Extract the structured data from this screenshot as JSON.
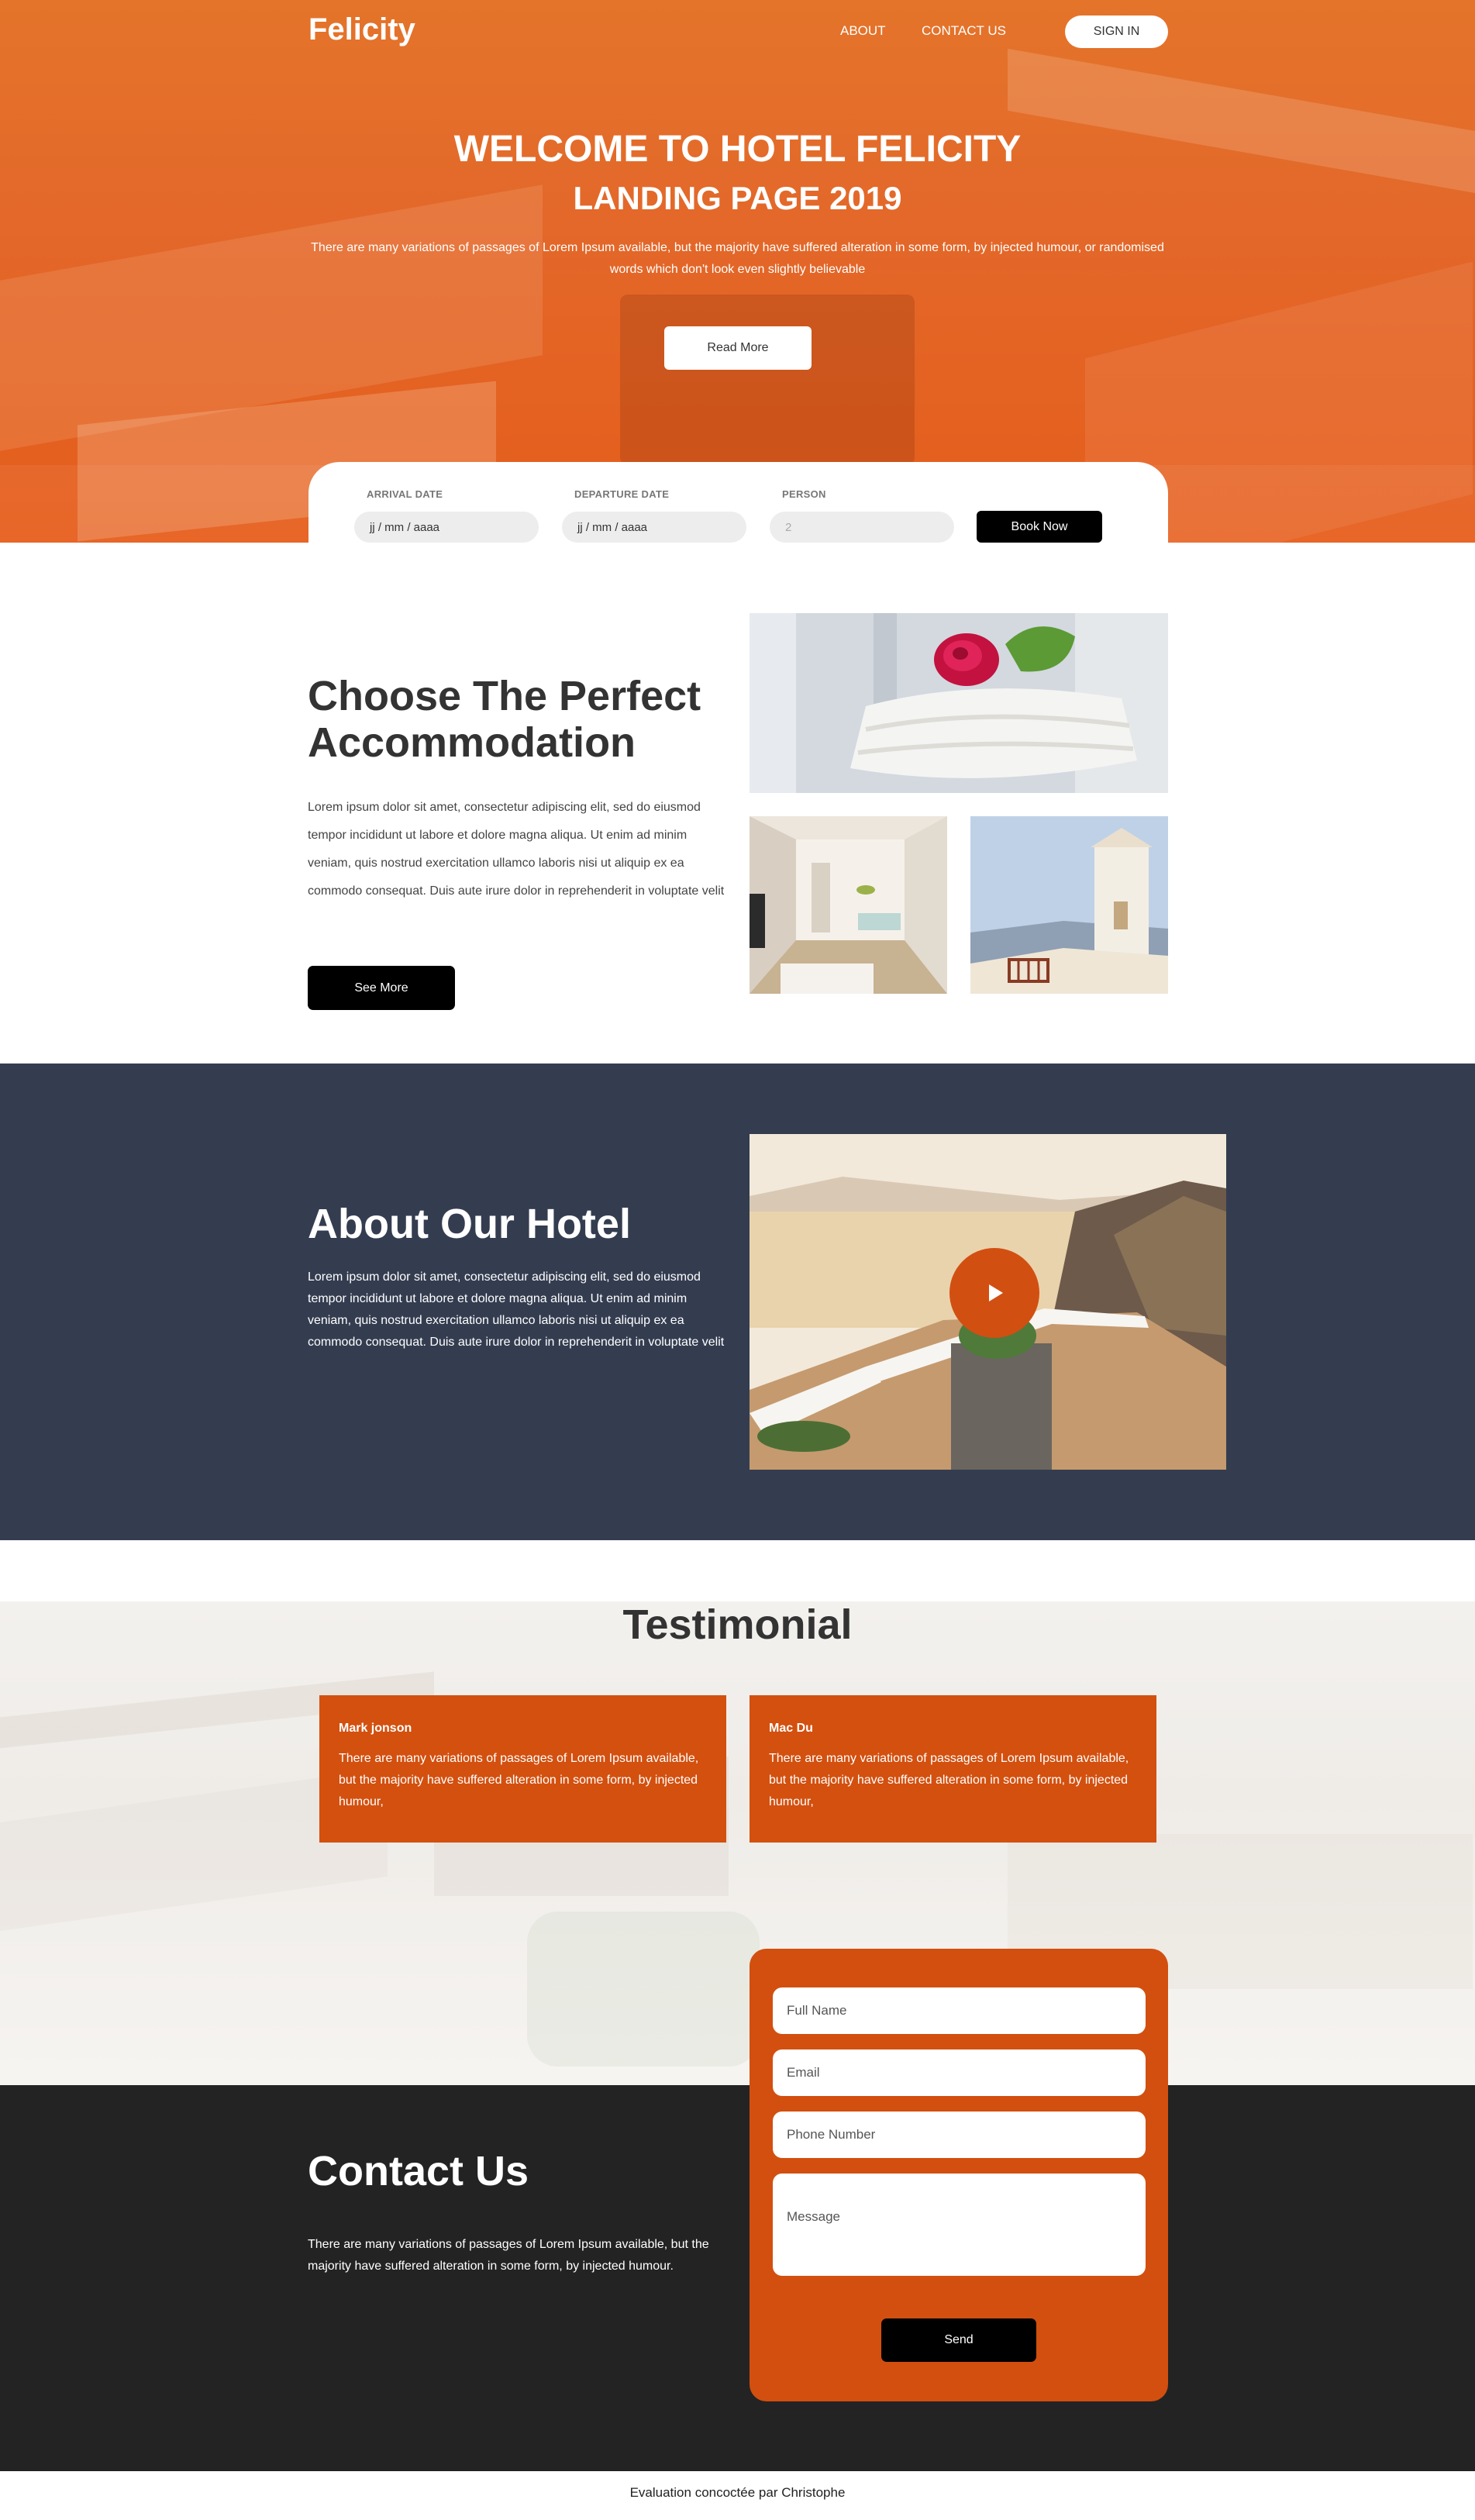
{
  "nav": {
    "logo": "Felicity",
    "about": "ABOUT",
    "contact": "CONTACT US",
    "signin": "SIGN IN"
  },
  "hero": {
    "title": "WELCOME TO HOTEL FELICITY",
    "subtitle": "LANDING PAGE 2019",
    "text": "There are many variations of passages of Lorem Ipsum available, but the majority have suffered alteration in some form, by injected humour, or randomised words which don't look even slightly believable",
    "button": "Read More"
  },
  "booking": {
    "arrival_label": "ARRIVAL DATE",
    "arrival_value": "jj / mm / aaaa",
    "departure_label": "DEPARTURE DATE",
    "departure_value": "jj / mm / aaaa",
    "person_label": "PERSON",
    "person_placeholder": "2",
    "button": "Book Now"
  },
  "accommodation": {
    "title": "Choose The Perfect Accommodation",
    "text": "Lorem ipsum dolor sit amet, consectetur adipiscing elit, sed do eiusmod tempor incididunt ut labore et dolore magna aliqua. Ut enim ad minim veniam, quis nostrud exercitation ullamco laboris nisi ut aliquip ex ea commodo consequat. Duis aute irure dolor in reprehenderit in voluptate velit",
    "button": "See More"
  },
  "about": {
    "title": "About Our Hotel",
    "text": "Lorem ipsum dolor sit amet, consectetur adipiscing elit, sed do eiusmod tempor incididunt ut labore et dolore magna aliqua. Ut enim ad minim veniam, quis nostrud exercitation ullamco laboris nisi ut aliquip ex ea commodo consequat. Duis aute irure dolor in reprehenderit in voluptate velit"
  },
  "testimonial": {
    "title": "Testimonial",
    "cards": [
      {
        "name": "Mark jonson",
        "text": "There are many variations of passages of Lorem Ipsum available, but the majority have suffered alteration in some form, by injected humour,"
      },
      {
        "name": "Mac Du",
        "text": "There are many variations of passages of Lorem Ipsum available, but the majority have suffered alteration in some form, by injected humour,"
      }
    ]
  },
  "contact": {
    "title": "Contact Us",
    "text": "There are many variations of passages of Lorem Ipsum available, but the majority have suffered alteration in some form, by injected humour.",
    "fullname_placeholder": "Full Name",
    "email_placeholder": "Email",
    "phone_placeholder": "Phone Number",
    "message_placeholder": "Message",
    "send": "Send"
  },
  "footer": {
    "text": "Evaluation concoctée par Christophe"
  },
  "colors": {
    "accent": "#d24f0f",
    "dark_navy": "#343d50",
    "dark": "#232323"
  }
}
